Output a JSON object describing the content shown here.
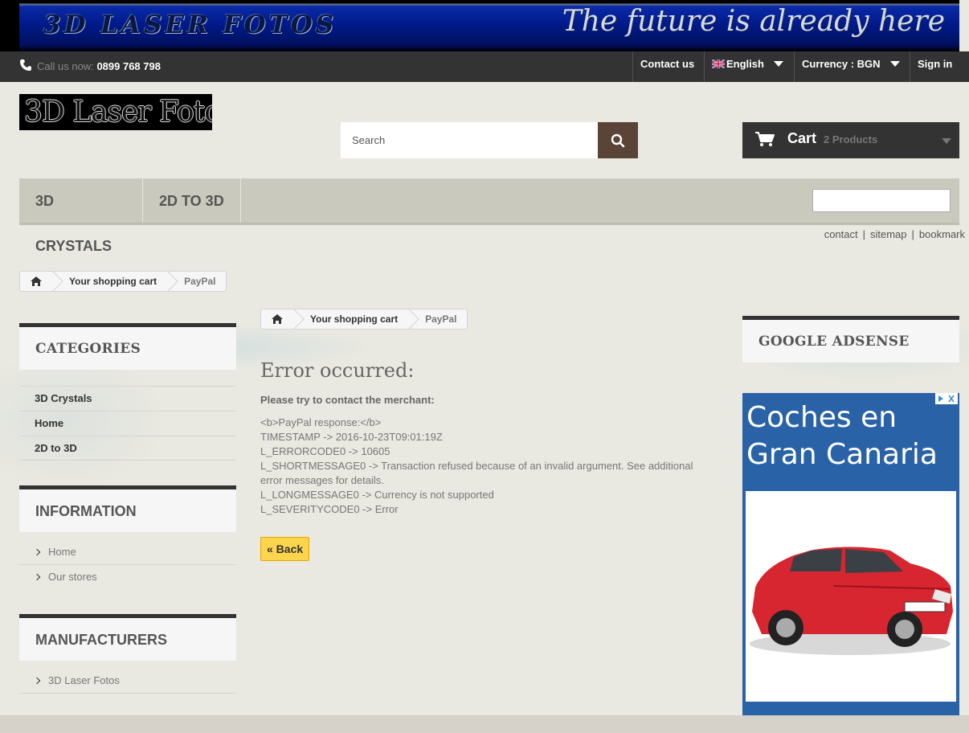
{
  "banner": {
    "title": "3D LASER FOTOS",
    "tagline": "The future is already here"
  },
  "navbar": {
    "phone_prefix": "Call us now:",
    "phone_number": "0899 768 798",
    "contact": "Contact us",
    "language": "English",
    "currency": "Currency : BGN",
    "signin": "Sign in"
  },
  "header": {
    "logo_text": "3D Laser Fotos",
    "search_placeholder": "Search",
    "cart_label": "Cart",
    "cart_count": "2 Products"
  },
  "menu": {
    "items": [
      "3D CRYSTALS",
      "2D TO 3D"
    ]
  },
  "util_links": [
    "contact",
    "sitemap",
    "bookmark"
  ],
  "breadcrumb": {
    "items": [
      "Your shopping cart",
      "PayPal"
    ]
  },
  "sidebar": {
    "categories_title": "CATEGORIES",
    "categories": [
      "3D Crystals",
      "Home",
      "2D to 3D"
    ],
    "information_title": "INFORMATION",
    "information": [
      "Home",
      "Our stores"
    ],
    "manufacturers_title": "MANUFACTURERS",
    "manufacturers": [
      "3D Laser Fotos"
    ]
  },
  "main": {
    "title": "Error occurred:",
    "subtitle": "Please try to contact the merchant:",
    "lines": [
      "<b>PayPal response:</b>",
      "TIMESTAMP -> 2016-10-23T09:01:19Z",
      "L_ERRORCODE0 -> 10605",
      "L_SHORTMESSAGE0 -> Transaction refused because of an invalid argument. See additional error messages for details.",
      "L_LONGMESSAGE0 -> Currency is not supported",
      "L_SEVERITYCODE0 -> Error"
    ],
    "back_button": "« Back"
  },
  "right": {
    "adsense_title": "GOOGLE ADSENSE",
    "ad_headline_1": "Coches en",
    "ad_headline_2": "Gran Canaria"
  },
  "colors": {
    "navbar_bg": "#333333",
    "menu_bg": "#c9c9bd",
    "search_button": "#5a4337",
    "back_button": "#fcd54d",
    "ad_bg": "#2a62a8"
  }
}
